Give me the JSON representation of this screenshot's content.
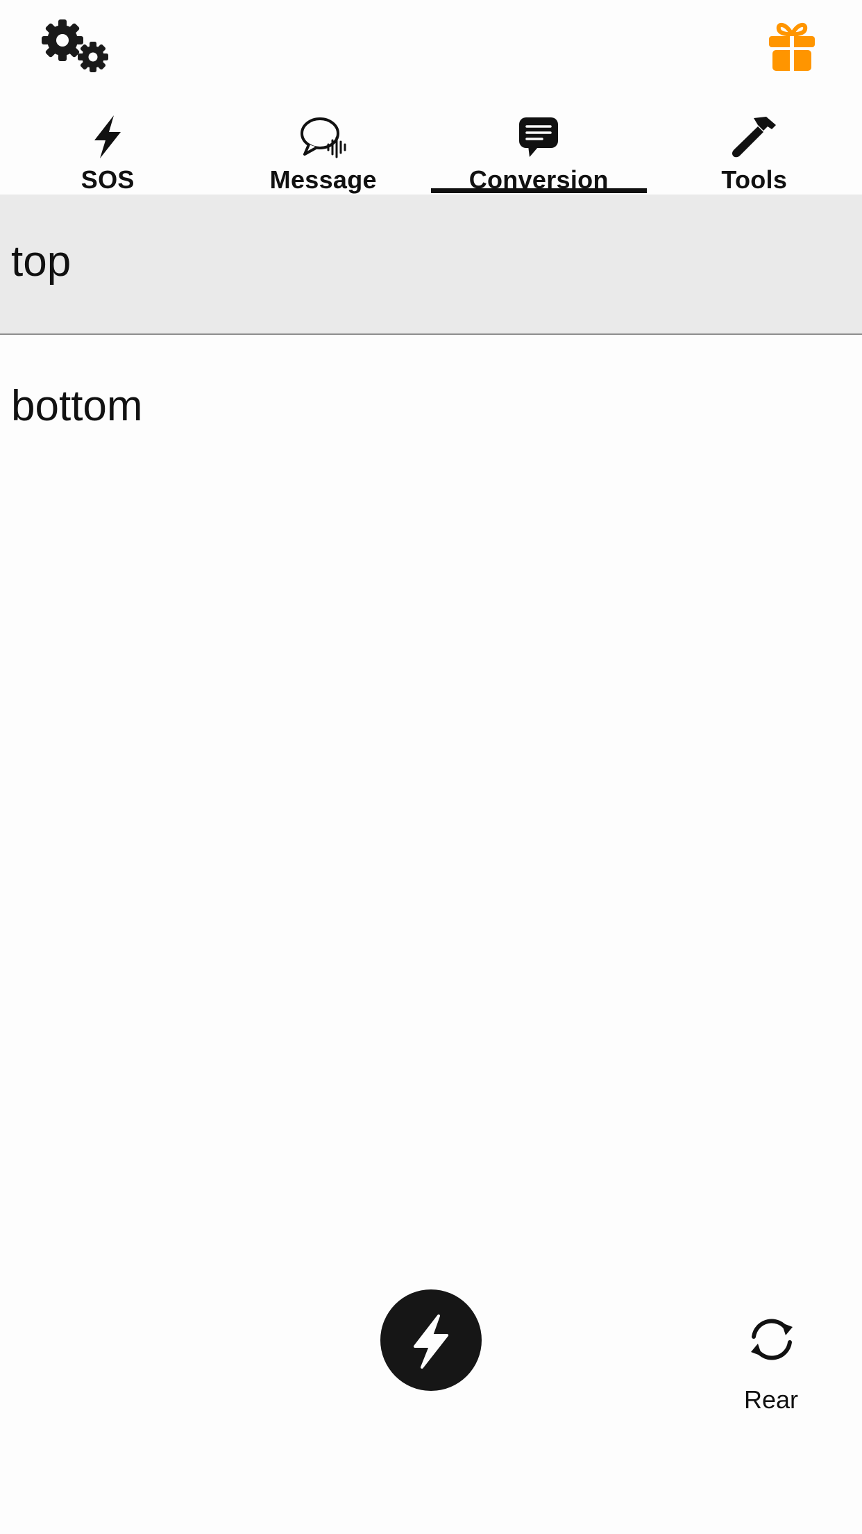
{
  "header": {
    "settings_icon": "gears-icon",
    "gift_icon": "gift-icon",
    "gift_color": "#FF9500"
  },
  "tabs": [
    {
      "label": "SOS",
      "icon": "bolt-icon",
      "active": false
    },
    {
      "label": "Message",
      "icon": "speech-bubble-audio-icon",
      "active": false
    },
    {
      "label": "Conversion",
      "icon": "chat-text-icon",
      "active": true
    },
    {
      "label": "Tools",
      "icon": "hammer-icon",
      "active": false
    }
  ],
  "conversion": {
    "top_text": "top",
    "bottom_text": "bottom",
    "top_background": "#EAEAEA"
  },
  "controls": {
    "flash_icon": "bolt-icon",
    "rear_label": "Rear",
    "rear_icon": "camera-switch-icon"
  }
}
